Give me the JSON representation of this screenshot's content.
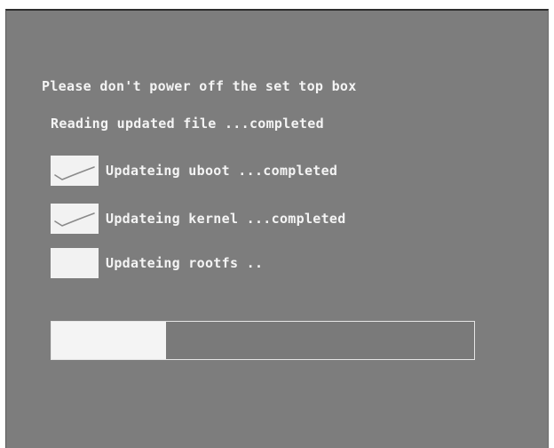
{
  "messages": {
    "warning": "Please don't power off the set top box",
    "reading": "Reading updated file ...completed"
  },
  "steps": [
    {
      "label": "Updateing uboot ...completed",
      "checked": true,
      "icon": "checkmark-icon"
    },
    {
      "label": "Updateing kernel ...completed",
      "checked": true,
      "icon": "checkmark-icon"
    },
    {
      "label": "Updateing rootfs ..",
      "checked": false,
      "icon": ""
    }
  ],
  "progress": {
    "fraction": 0.27
  },
  "colors": {
    "background": "#7d7d7d",
    "text": "#f4f4f4",
    "checkbox": "#f2f2f2",
    "progress_fill": "#f4f4f4"
  }
}
